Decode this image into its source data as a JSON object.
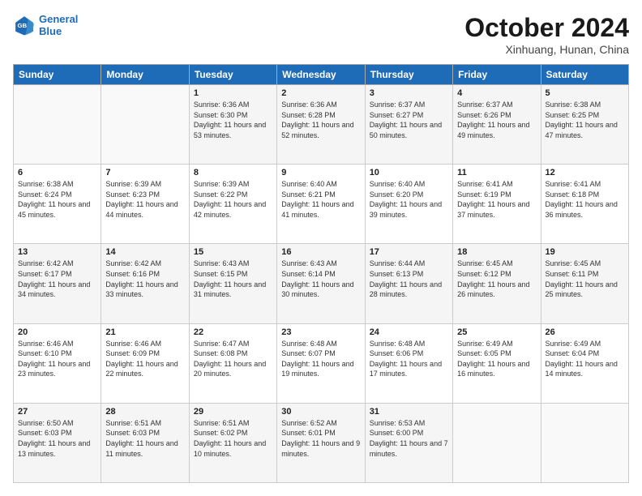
{
  "logo": {
    "line1": "General",
    "line2": "Blue"
  },
  "title": "October 2024",
  "location": "Xinhuang, Hunan, China",
  "days_of_week": [
    "Sunday",
    "Monday",
    "Tuesday",
    "Wednesday",
    "Thursday",
    "Friday",
    "Saturday"
  ],
  "weeks": [
    [
      {
        "day": "",
        "info": ""
      },
      {
        "day": "",
        "info": ""
      },
      {
        "day": "1",
        "info": "Sunrise: 6:36 AM\nSunset: 6:30 PM\nDaylight: 11 hours and 53 minutes."
      },
      {
        "day": "2",
        "info": "Sunrise: 6:36 AM\nSunset: 6:28 PM\nDaylight: 11 hours and 52 minutes."
      },
      {
        "day": "3",
        "info": "Sunrise: 6:37 AM\nSunset: 6:27 PM\nDaylight: 11 hours and 50 minutes."
      },
      {
        "day": "4",
        "info": "Sunrise: 6:37 AM\nSunset: 6:26 PM\nDaylight: 11 hours and 49 minutes."
      },
      {
        "day": "5",
        "info": "Sunrise: 6:38 AM\nSunset: 6:25 PM\nDaylight: 11 hours and 47 minutes."
      }
    ],
    [
      {
        "day": "6",
        "info": "Sunrise: 6:38 AM\nSunset: 6:24 PM\nDaylight: 11 hours and 45 minutes."
      },
      {
        "day": "7",
        "info": "Sunrise: 6:39 AM\nSunset: 6:23 PM\nDaylight: 11 hours and 44 minutes."
      },
      {
        "day": "8",
        "info": "Sunrise: 6:39 AM\nSunset: 6:22 PM\nDaylight: 11 hours and 42 minutes."
      },
      {
        "day": "9",
        "info": "Sunrise: 6:40 AM\nSunset: 6:21 PM\nDaylight: 11 hours and 41 minutes."
      },
      {
        "day": "10",
        "info": "Sunrise: 6:40 AM\nSunset: 6:20 PM\nDaylight: 11 hours and 39 minutes."
      },
      {
        "day": "11",
        "info": "Sunrise: 6:41 AM\nSunset: 6:19 PM\nDaylight: 11 hours and 37 minutes."
      },
      {
        "day": "12",
        "info": "Sunrise: 6:41 AM\nSunset: 6:18 PM\nDaylight: 11 hours and 36 minutes."
      }
    ],
    [
      {
        "day": "13",
        "info": "Sunrise: 6:42 AM\nSunset: 6:17 PM\nDaylight: 11 hours and 34 minutes."
      },
      {
        "day": "14",
        "info": "Sunrise: 6:42 AM\nSunset: 6:16 PM\nDaylight: 11 hours and 33 minutes."
      },
      {
        "day": "15",
        "info": "Sunrise: 6:43 AM\nSunset: 6:15 PM\nDaylight: 11 hours and 31 minutes."
      },
      {
        "day": "16",
        "info": "Sunrise: 6:43 AM\nSunset: 6:14 PM\nDaylight: 11 hours and 30 minutes."
      },
      {
        "day": "17",
        "info": "Sunrise: 6:44 AM\nSunset: 6:13 PM\nDaylight: 11 hours and 28 minutes."
      },
      {
        "day": "18",
        "info": "Sunrise: 6:45 AM\nSunset: 6:12 PM\nDaylight: 11 hours and 26 minutes."
      },
      {
        "day": "19",
        "info": "Sunrise: 6:45 AM\nSunset: 6:11 PM\nDaylight: 11 hours and 25 minutes."
      }
    ],
    [
      {
        "day": "20",
        "info": "Sunrise: 6:46 AM\nSunset: 6:10 PM\nDaylight: 11 hours and 23 minutes."
      },
      {
        "day": "21",
        "info": "Sunrise: 6:46 AM\nSunset: 6:09 PM\nDaylight: 11 hours and 22 minutes."
      },
      {
        "day": "22",
        "info": "Sunrise: 6:47 AM\nSunset: 6:08 PM\nDaylight: 11 hours and 20 minutes."
      },
      {
        "day": "23",
        "info": "Sunrise: 6:48 AM\nSunset: 6:07 PM\nDaylight: 11 hours and 19 minutes."
      },
      {
        "day": "24",
        "info": "Sunrise: 6:48 AM\nSunset: 6:06 PM\nDaylight: 11 hours and 17 minutes."
      },
      {
        "day": "25",
        "info": "Sunrise: 6:49 AM\nSunset: 6:05 PM\nDaylight: 11 hours and 16 minutes."
      },
      {
        "day": "26",
        "info": "Sunrise: 6:49 AM\nSunset: 6:04 PM\nDaylight: 11 hours and 14 minutes."
      }
    ],
    [
      {
        "day": "27",
        "info": "Sunrise: 6:50 AM\nSunset: 6:03 PM\nDaylight: 11 hours and 13 minutes."
      },
      {
        "day": "28",
        "info": "Sunrise: 6:51 AM\nSunset: 6:03 PM\nDaylight: 11 hours and 11 minutes."
      },
      {
        "day": "29",
        "info": "Sunrise: 6:51 AM\nSunset: 6:02 PM\nDaylight: 11 hours and 10 minutes."
      },
      {
        "day": "30",
        "info": "Sunrise: 6:52 AM\nSunset: 6:01 PM\nDaylight: 11 hours and 9 minutes."
      },
      {
        "day": "31",
        "info": "Sunrise: 6:53 AM\nSunset: 6:00 PM\nDaylight: 11 hours and 7 minutes."
      },
      {
        "day": "",
        "info": ""
      },
      {
        "day": "",
        "info": ""
      }
    ]
  ]
}
